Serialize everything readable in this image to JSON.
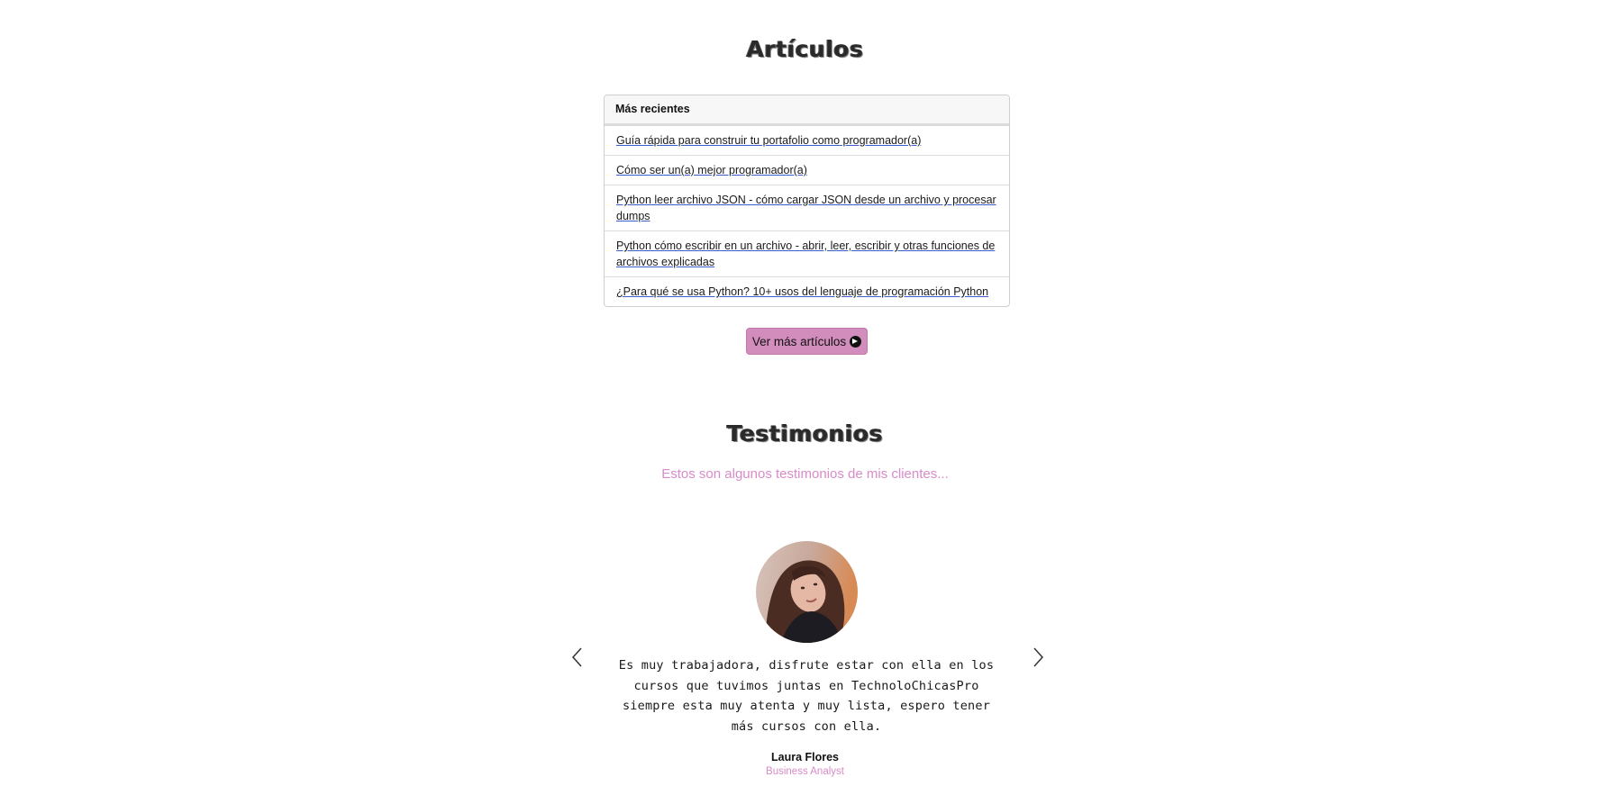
{
  "articles": {
    "title": "Artículos",
    "list_header": "Más recientes",
    "items": [
      {
        "label": "Guía rápida para construir tu portafolio como programador(a)"
      },
      {
        "label": "Cómo ser un(a) mejor programador(a)"
      },
      {
        "label": "Python leer archivo JSON - cómo cargar JSON desde un archivo y procesar dumps"
      },
      {
        "label": "Python cómo escribir en un archivo - abrir, leer, escribir y otras funciones de archivos explicadas"
      },
      {
        "label": "¿Para qué se usa Python? 10+ usos del lenguaje de programación Python"
      }
    ],
    "more_button_label": "Ver más artículos",
    "more_button_icon": "arrow-right-circle-icon",
    "button_color": "#d28dbd"
  },
  "testimonials": {
    "title": "Testimonios",
    "subtitle": "Estos son algunos testimonios de mis clientes...",
    "accent_color": "#d88bc8",
    "current": {
      "quote": "Es muy trabajadora, disfrute estar con ella en los cursos que tuvimos juntas en TechnoloChicasPro siempre esta muy atenta y muy lista, espero tener más cursos con ella.",
      "name": "Laura Flores",
      "role": "Business Analyst"
    },
    "prev_icon": "chevron-left-icon",
    "next_icon": "chevron-right-icon"
  }
}
